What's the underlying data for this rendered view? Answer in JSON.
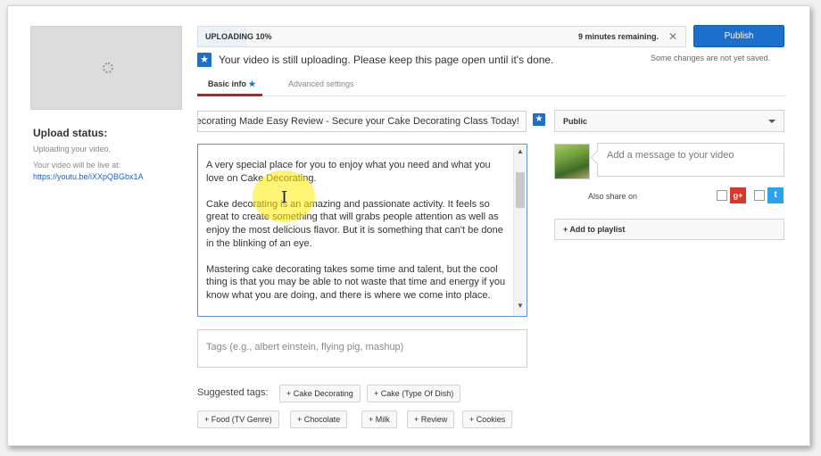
{
  "upload": {
    "progress_label": "UPLOADING 10%",
    "progress_fraction": 0.1,
    "time_remaining": "9 minutes remaining.",
    "close_glyph": "✕",
    "notice": "Your video is still uploading. Please keep this page open until it's done.",
    "unsaved": "Some changes are not yet saved."
  },
  "publish_label": "Publish",
  "status": {
    "title": "Upload status:",
    "line1": "Uploading your video.",
    "line2": "Your video will be live at:",
    "link": "https://youtu.be/iXXpQBGbx1A"
  },
  "tabs": {
    "basic": "Basic info",
    "basic_star": "★",
    "advanced": "Advanced settings"
  },
  "video": {
    "title": "Cake Decorating Made Easy Review - Secure your Cake Decorating Class Today!",
    "description": [
      "A very special place for you to enjoy what you need and what you love on Cake Decorating.",
      "Cake decorating is an amazing and passionate activity. It feels so great to create something that will grabs people attention as well as enjoy the most delicious flavor. But it is something that can't be done in the blinking of an eye.",
      "Mastering cake decorating takes some time and talent, but the cool thing is that you may be able to not waste that time and energy if you know what you are doing, and there is where we come into place."
    ]
  },
  "privacy": {
    "value": "Public"
  },
  "share": {
    "placeholder": "Add a message to your video",
    "also_share": "Also share on",
    "gplus": "g+",
    "twitter": "t"
  },
  "add_playlist": "+ Add to playlist",
  "tags": {
    "placeholder": "Tags (e.g., albert einstein, flying pig, mashup)",
    "suggested_label": "Suggested tags:",
    "suggested": [
      "+ Cake Decorating",
      "+ Cake (Type Of Dish)",
      "+ Food (TV Genre)",
      "+ Chocolate",
      "+ Milk",
      "+ Review",
      "+ Cookies"
    ]
  },
  "icons": {
    "star": "★",
    "scroll_up": "▲",
    "scroll_down": "▼",
    "text_cursor": "I"
  },
  "colors": {
    "accent_blue": "#1c6fcc",
    "tab_red": "#cc181e",
    "link_blue": "#1c62b9",
    "gplus_red": "#d6382c",
    "twitter_blue": "#2aa3ef",
    "highlight_yellow": "#ffeb00"
  }
}
